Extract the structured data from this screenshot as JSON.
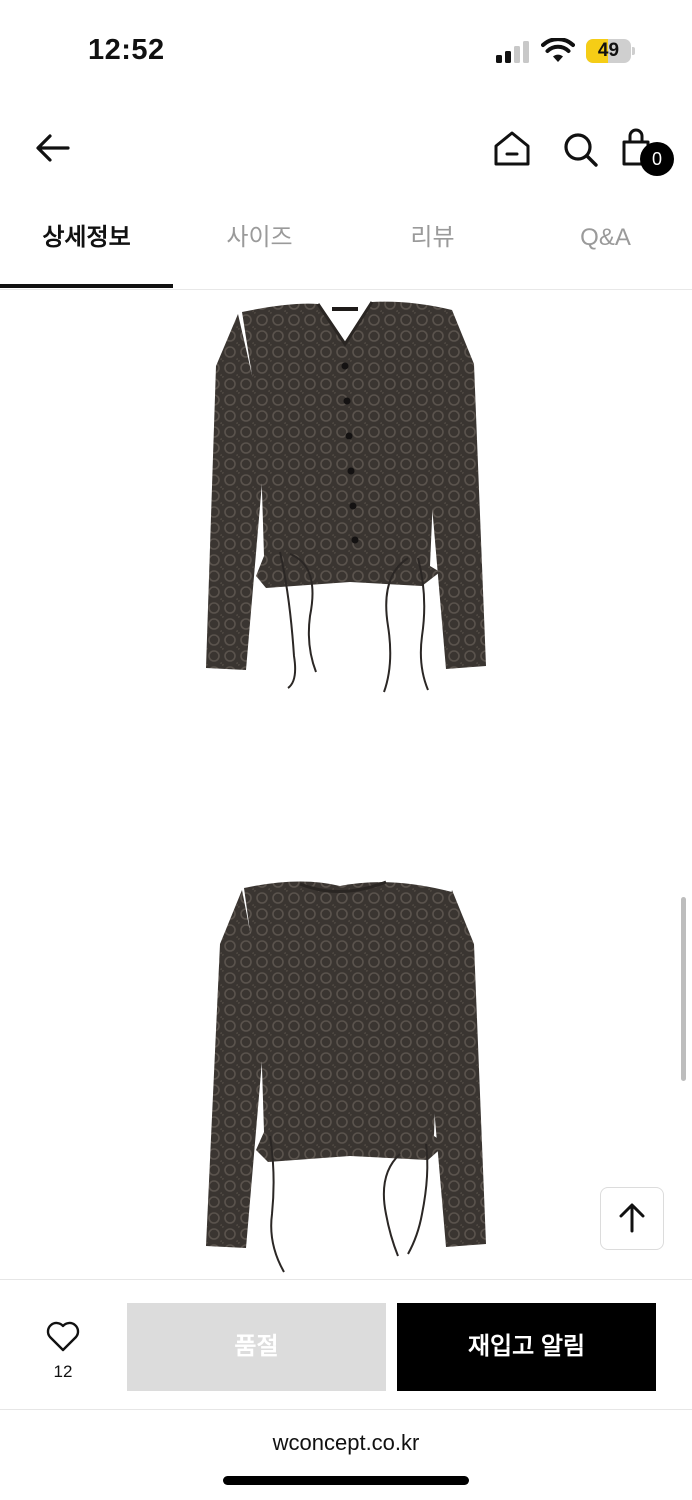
{
  "status_bar": {
    "time": "12:52",
    "battery_level": "49",
    "battery_fraction": 0.49
  },
  "header": {
    "back_icon": "arrow-left-icon",
    "home_icon": "home-icon",
    "search_icon": "search-icon",
    "cart_icon": "shopping-bag-icon",
    "cart_count": "0"
  },
  "tabs": [
    {
      "label": "상세정보",
      "active": true
    },
    {
      "label": "사이즈",
      "active": false
    },
    {
      "label": "리뷰",
      "active": false
    },
    {
      "label": "Q&A",
      "active": false
    }
  ],
  "product_images": [
    {
      "subject": "dark lace cardigan with side ties (front)"
    },
    {
      "subject": "dark lace top with side ties (back)"
    }
  ],
  "scroll_top_icon": "arrow-up-icon",
  "bottom_bar": {
    "like_icon": "heart-icon",
    "like_count": "12",
    "soldout_label": "품절",
    "restock_label": "재입고 알림"
  },
  "browser": {
    "url": "wconcept.co.kr"
  },
  "colors": {
    "accent": "#000000",
    "soldout_bg": "#dcdcdc",
    "battery": "#f5cd16",
    "tab_inactive": "#9a9a9a"
  }
}
